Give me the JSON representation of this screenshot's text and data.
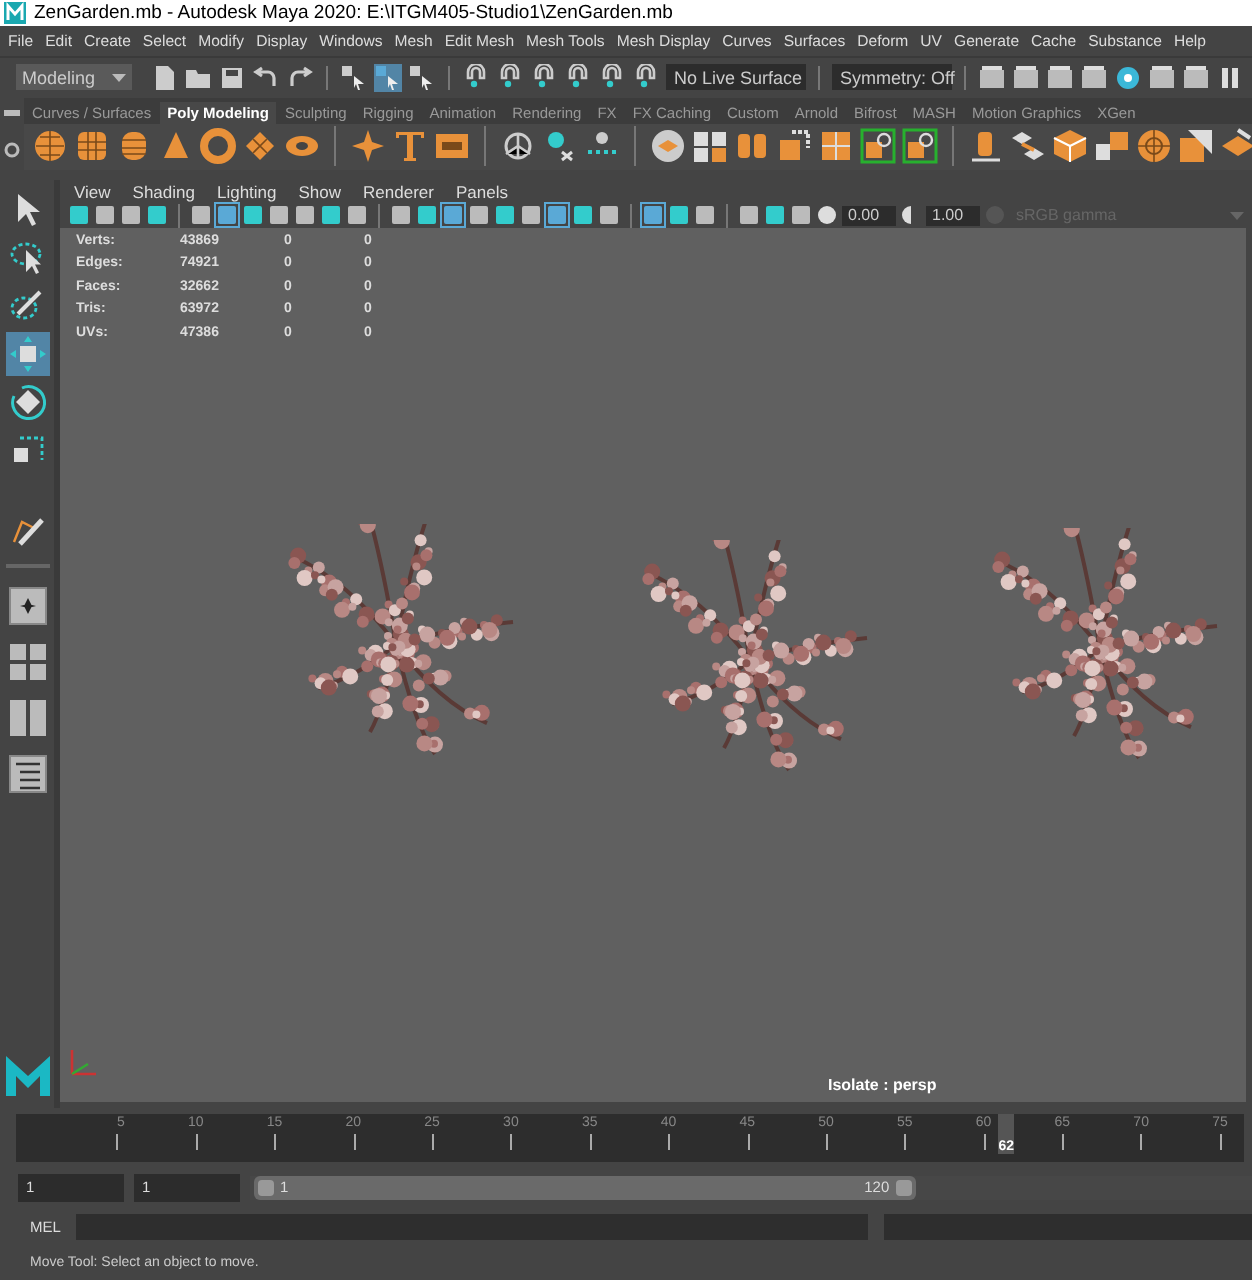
{
  "window": {
    "title": "ZenGarden.mb - Autodesk Maya 2020: E:\\ITGM405-Studio1\\ZenGarden.mb"
  },
  "menu_bar": [
    "File",
    "Edit",
    "Create",
    "Select",
    "Modify",
    "Display",
    "Windows",
    "Mesh",
    "Edit Mesh",
    "Mesh Tools",
    "Mesh Display",
    "Curves",
    "Surfaces",
    "Deform",
    "UV",
    "Generate",
    "Cache",
    "Substance",
    "Help"
  ],
  "status_line": {
    "mode": "Modeling",
    "live_surface": "No Live Surface",
    "symmetry": "Symmetry: Off"
  },
  "shelf": {
    "tabs": [
      {
        "label": "Curves / Surfaces",
        "selected": false
      },
      {
        "label": "Poly Modeling",
        "selected": true
      },
      {
        "label": "Sculpting",
        "selected": false
      },
      {
        "label": "Rigging",
        "selected": false
      },
      {
        "label": "Animation",
        "selected": false
      },
      {
        "label": "Rendering",
        "selected": false
      },
      {
        "label": "FX",
        "selected": false
      },
      {
        "label": "FX Caching",
        "selected": false
      },
      {
        "label": "Custom",
        "selected": false
      },
      {
        "label": "Arnold",
        "selected": false
      },
      {
        "label": "Bifrost",
        "selected": false
      },
      {
        "label": "MASH",
        "selected": false
      },
      {
        "label": "Motion Graphics",
        "selected": false
      },
      {
        "label": "XGen",
        "selected": false
      }
    ]
  },
  "toolbox": [
    {
      "kind": "select",
      "selected": false
    },
    {
      "kind": "lasso",
      "selected": false
    },
    {
      "kind": "paint",
      "selected": false
    },
    {
      "kind": "move",
      "selected": true
    },
    {
      "kind": "rotate",
      "selected": false
    },
    {
      "kind": "scale",
      "selected": false
    }
  ],
  "viewport": {
    "menu": [
      "View",
      "Shading",
      "Lighting",
      "Show",
      "Renderer",
      "Panels"
    ],
    "exposure": "0.00",
    "gamma": "1.00",
    "color_space": "sRGB gamma",
    "stats": [
      {
        "label": "Verts:",
        "values": [
          "43869",
          "0",
          "0"
        ]
      },
      {
        "label": "Edges:",
        "values": [
          "74921",
          "0",
          "0"
        ]
      },
      {
        "label": "Faces:",
        "values": [
          "32662",
          "0",
          "0"
        ]
      },
      {
        "label": "Tris:",
        "values": [
          "63972",
          "0",
          "0"
        ]
      },
      {
        "label": "UVs:",
        "values": [
          "47386",
          "0",
          "0"
        ]
      }
    ],
    "isolate": "Isolate : persp"
  },
  "timeline": {
    "ticks": [
      "5",
      "10",
      "15",
      "20",
      "25",
      "30",
      "35",
      "40",
      "45",
      "50",
      "55",
      "60",
      "65",
      "70",
      "75"
    ],
    "current": "62",
    "level": 0.8
  },
  "range": {
    "start": "1",
    "anim_start": "1",
    "slider_start": "1",
    "slider_end": "120",
    "level": 0.66
  },
  "command_line": {
    "label": "MEL"
  },
  "help_line": "Move Tool: Select an object to move."
}
